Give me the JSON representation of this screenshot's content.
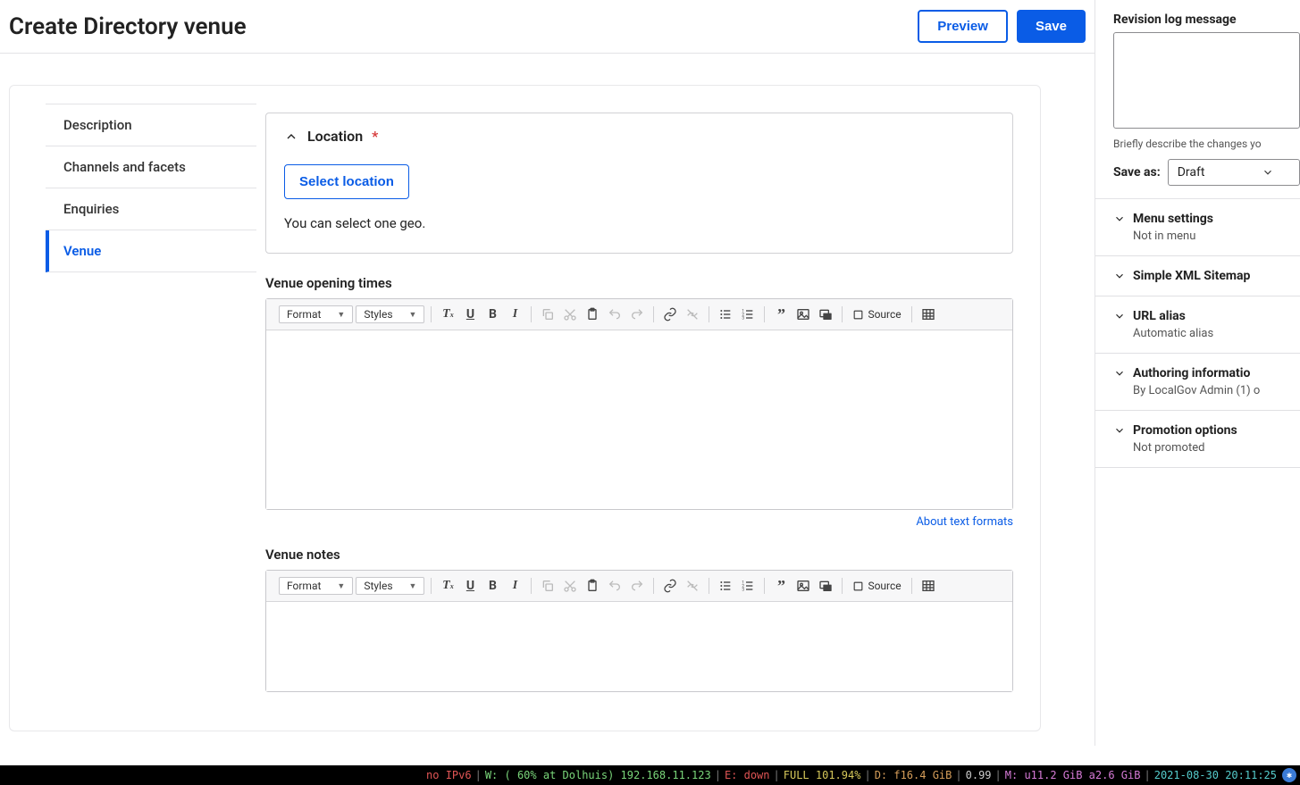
{
  "header": {
    "title": "Create Directory venue",
    "preview": "Preview",
    "save": "Save"
  },
  "tabs": {
    "items": [
      {
        "label": "Description"
      },
      {
        "label": "Channels and facets"
      },
      {
        "label": "Enquiries"
      },
      {
        "label": "Venue"
      }
    ],
    "active": 3
  },
  "form": {
    "location": {
      "legend": "Location",
      "required": "*",
      "button": "Select location",
      "help": "You can select one geo."
    },
    "opening": {
      "label": "Venue opening times"
    },
    "notes": {
      "label": "Venue notes"
    },
    "about_link": "About text formats"
  },
  "rte": {
    "format": "Format",
    "styles": "Styles",
    "source": "Source"
  },
  "sidebar": {
    "revision": {
      "label": "Revision log message",
      "desc": "Briefly describe the changes yo"
    },
    "saveas": {
      "label": "Save as:",
      "value": "Draft"
    },
    "menu": {
      "title": "Menu settings",
      "sub": "Not in menu"
    },
    "sitemap": {
      "title": "Simple XML Sitemap"
    },
    "url": {
      "title": "URL alias",
      "sub": "Automatic alias"
    },
    "authoring": {
      "title": "Authoring informatio",
      "sub": "By LocalGov Admin (1) o"
    },
    "promotion": {
      "title": "Promotion options",
      "sub": "Not promoted"
    }
  },
  "statusbar": {
    "ipv6": "no IPv6",
    "wifi": "W: ( 60% at Dolhuis) 192.168.11.123",
    "eth": "E: down",
    "batt": "FULL 101.94%",
    "disk": "D: f16.4 GiB",
    "load": "0.99",
    "mem": "M: u11.2 GiB a2.6 GiB",
    "time": "2021-08-30 20:11:25"
  }
}
